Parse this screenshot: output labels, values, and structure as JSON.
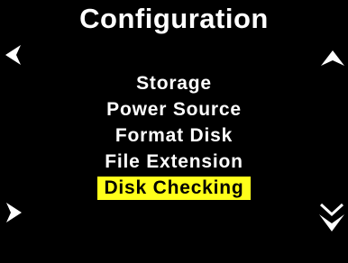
{
  "screen": {
    "title": "Configuration",
    "menu_items": [
      {
        "label": "Storage",
        "selected": false
      },
      {
        "label": "Power Source",
        "selected": false
      },
      {
        "label": "Format Disk",
        "selected": false
      },
      {
        "label": "File Extension",
        "selected": false
      },
      {
        "label": "Disk Checking",
        "selected": true
      }
    ]
  },
  "icons": {
    "left": "chevron-left-icon",
    "right": "chevron-right-icon",
    "up": "chevron-up-icon",
    "down": "double-chevron-down-icon"
  },
  "colors": {
    "background": "#000000",
    "text": "#ffffff",
    "highlight": "#ffff1a",
    "highlight_text": "#000000"
  }
}
